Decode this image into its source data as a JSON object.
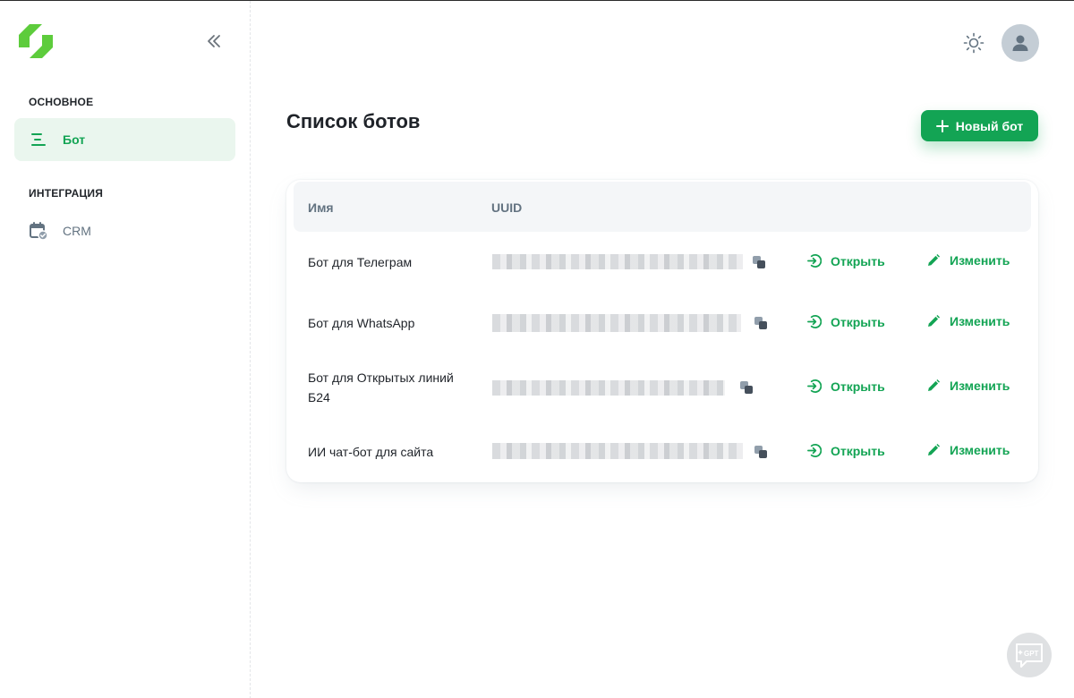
{
  "sidebar": {
    "sections": [
      {
        "title": "ОСНОВНОЕ",
        "items": [
          {
            "label": "Бот",
            "icon": "list-lines-icon",
            "active": true
          }
        ]
      },
      {
        "title": "ИНТЕГРАЦИЯ",
        "items": [
          {
            "label": "CRM",
            "icon": "calendar-check-icon",
            "active": false
          }
        ]
      }
    ]
  },
  "page": {
    "title": "Список ботов",
    "new_bot_label": "Новый бот"
  },
  "table": {
    "headers": {
      "name": "Имя",
      "uuid": "UUID"
    },
    "open_label": "Открыть",
    "edit_label": "Изменить",
    "rows": [
      {
        "name": "Бот для Телеграм"
      },
      {
        "name": "Бот для WhatsApp"
      },
      {
        "name": "Бот для Открытых линий Б24"
      },
      {
        "name": "ИИ чат-бот для сайта"
      }
    ]
  },
  "fab": {
    "label": "GPT"
  },
  "colors": {
    "accent": "#13a454",
    "active_bg": "#eaf6ee",
    "logo": "#5dcc3c"
  }
}
